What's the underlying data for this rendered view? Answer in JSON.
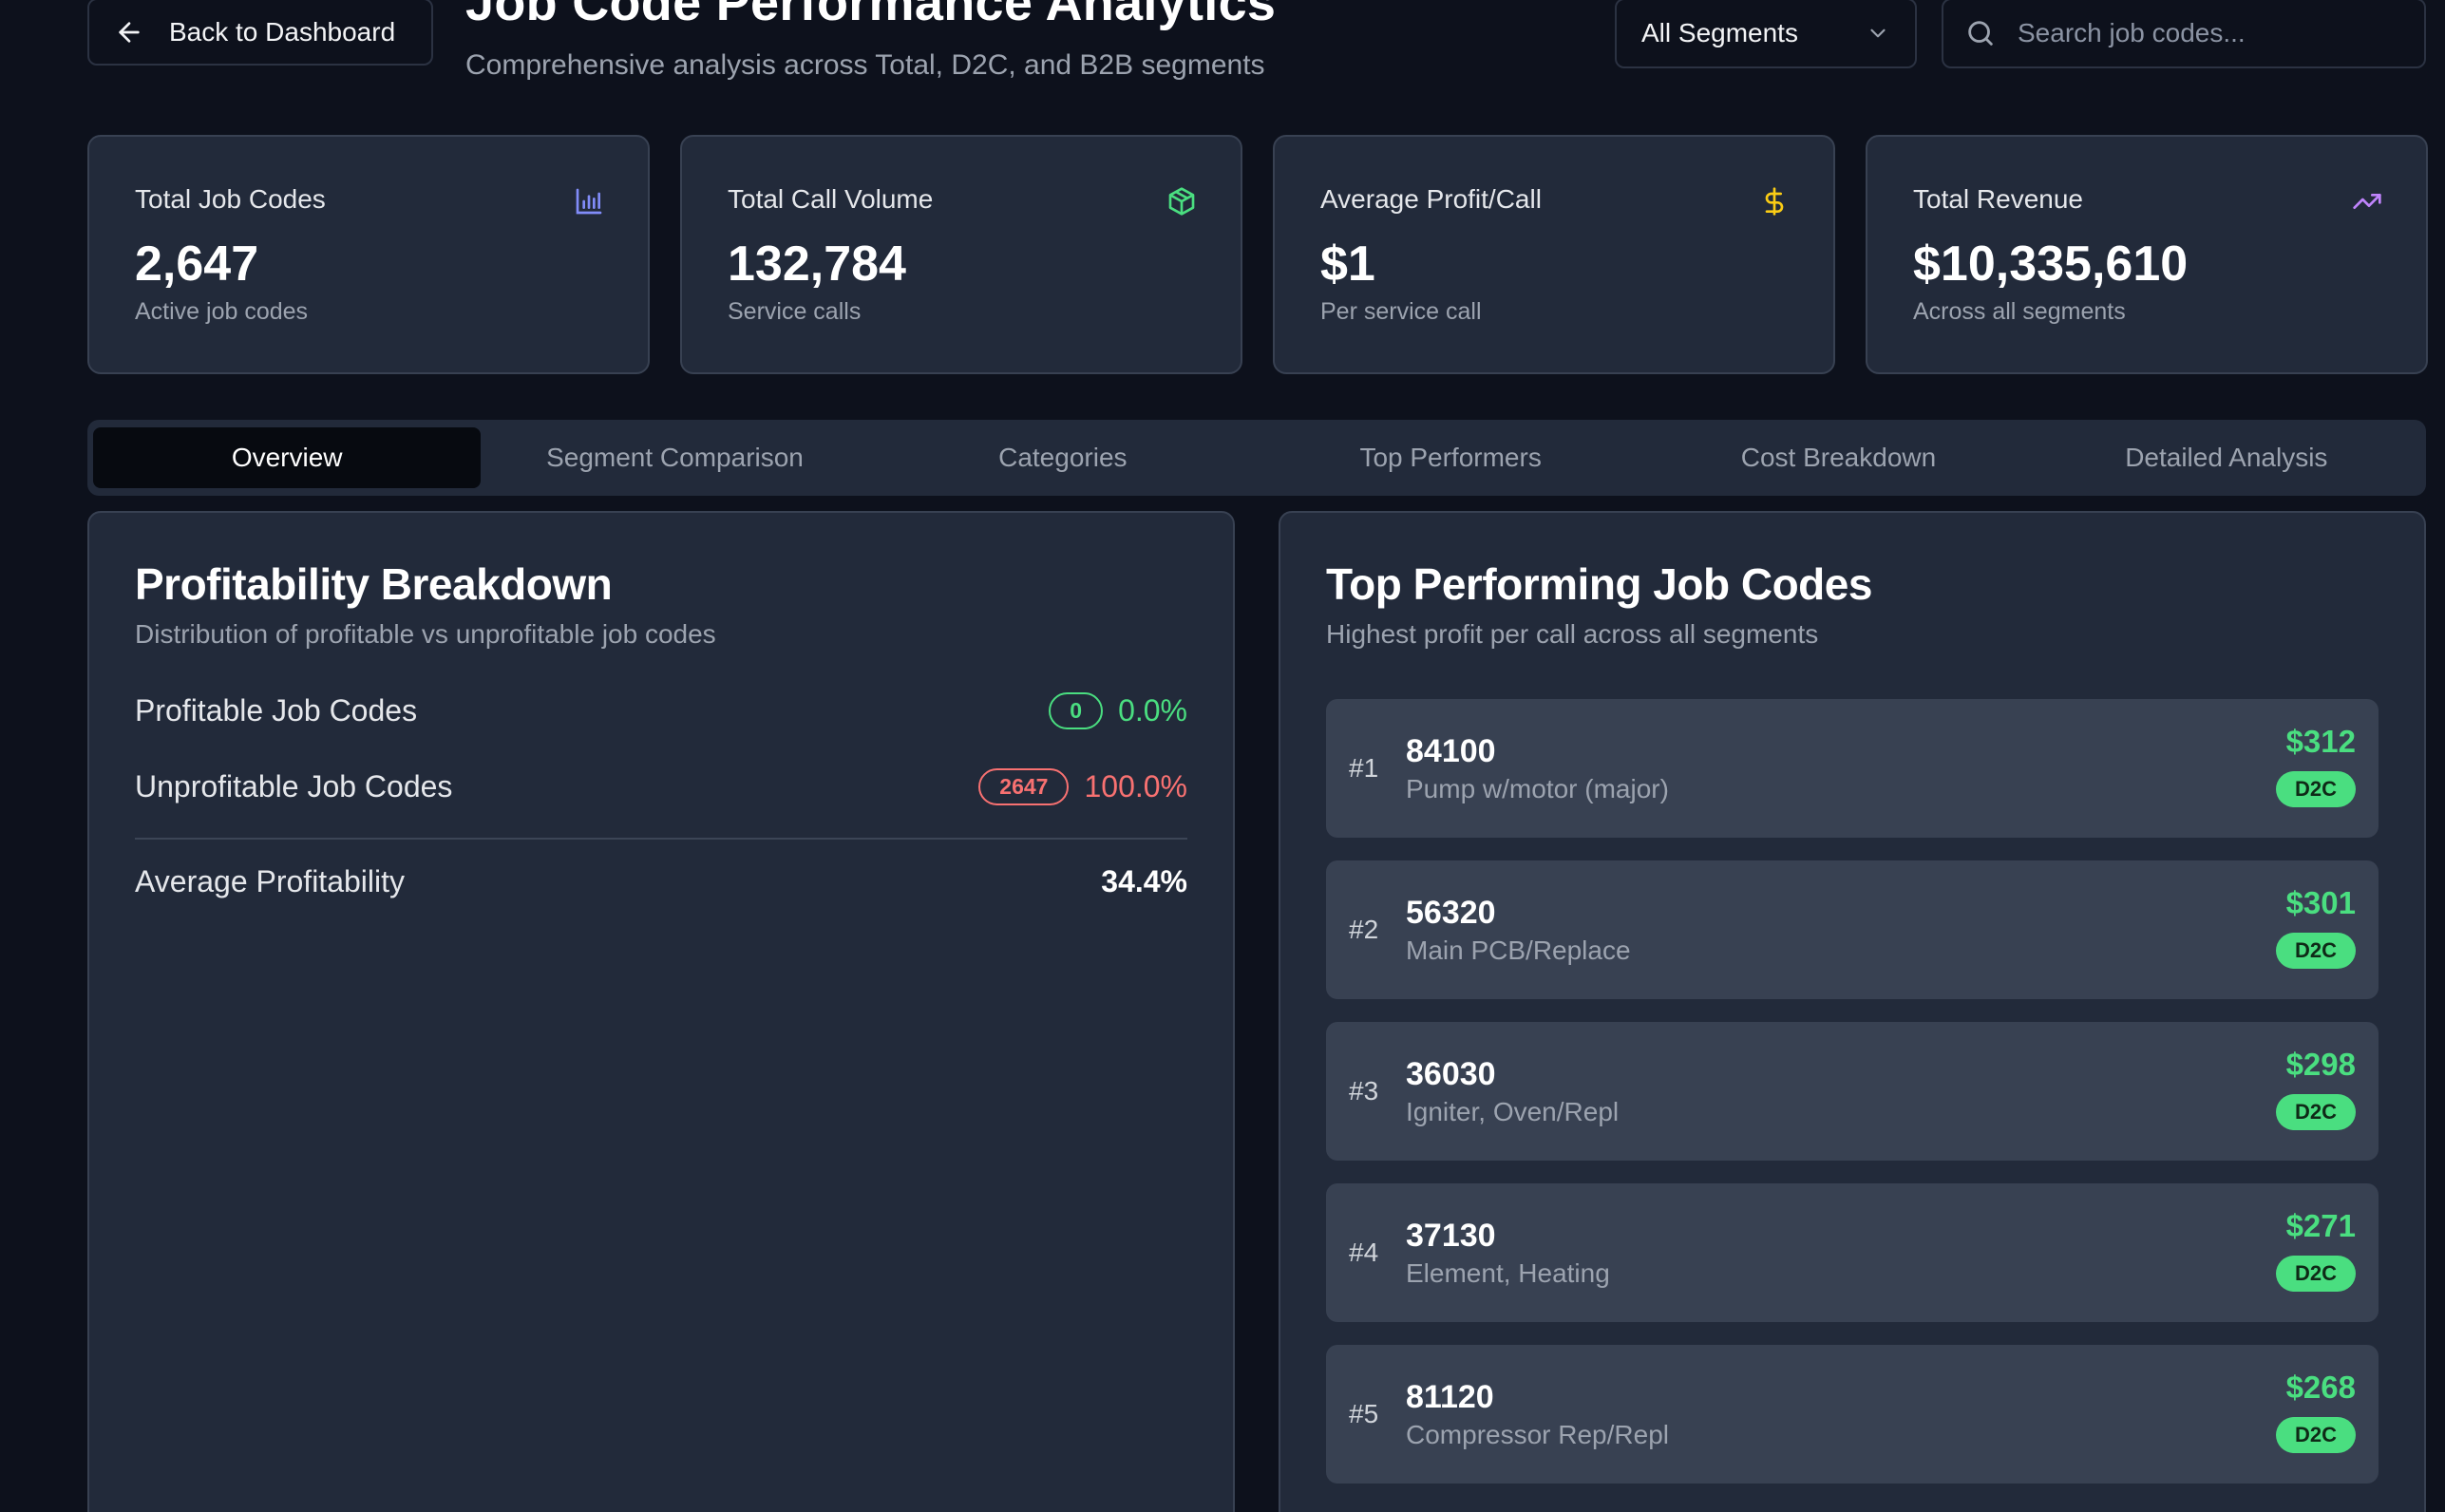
{
  "header": {
    "back_label": "Back to Dashboard",
    "title": "Job Code Performance Analytics",
    "subtitle": "Comprehensive analysis across Total, D2C, and B2B segments",
    "segment_selected": "All Segments",
    "search_placeholder": "Search job codes..."
  },
  "stats": [
    {
      "label": "Total Job Codes",
      "value": "2,647",
      "sub": "Active job codes",
      "icon": "bar-chart-icon",
      "icon_color": "#818cf8"
    },
    {
      "label": "Total Call Volume",
      "value": "132,784",
      "sub": "Service calls",
      "icon": "package-icon",
      "icon_color": "#4ade80"
    },
    {
      "label": "Average Profit/Call",
      "value": "$1",
      "sub": "Per service call",
      "icon": "dollar-icon",
      "icon_color": "#facc15"
    },
    {
      "label": "Total Revenue",
      "value": "$10,335,610",
      "sub": "Across all segments",
      "icon": "trending-up-icon",
      "icon_color": "#c084fc"
    }
  ],
  "tabs": [
    {
      "label": "Overview",
      "active": true
    },
    {
      "label": "Segment Comparison",
      "active": false
    },
    {
      "label": "Categories",
      "active": false
    },
    {
      "label": "Top Performers",
      "active": false
    },
    {
      "label": "Cost Breakdown",
      "active": false
    },
    {
      "label": "Detailed Analysis",
      "active": false
    }
  ],
  "profitability": {
    "title": "Profitability Breakdown",
    "subtitle": "Distribution of profitable vs unprofitable job codes",
    "profitable_label": "Profitable Job Codes",
    "profitable_count": "0",
    "profitable_pct": "0.0%",
    "unprofitable_label": "Unprofitable Job Codes",
    "unprofitable_count": "2647",
    "unprofitable_pct": "100.0%",
    "avg_label": "Average Profitability",
    "avg_value": "34.4%"
  },
  "top_performers": {
    "title": "Top Performing Job Codes",
    "subtitle": "Highest profit per call across all segments",
    "items": [
      {
        "rank": "#1",
        "code": "84100",
        "desc": "Pump w/motor (major)",
        "profit": "$312",
        "segment": "D2C"
      },
      {
        "rank": "#2",
        "code": "56320",
        "desc": "Main PCB/Replace",
        "profit": "$301",
        "segment": "D2C"
      },
      {
        "rank": "#3",
        "code": "36030",
        "desc": "Igniter, Oven/Repl",
        "profit": "$298",
        "segment": "D2C"
      },
      {
        "rank": "#4",
        "code": "37130",
        "desc": "Element, Heating",
        "profit": "$271",
        "segment": "D2C"
      },
      {
        "rank": "#5",
        "code": "81120",
        "desc": "Compressor Rep/Repl",
        "profit": "$268",
        "segment": "D2C"
      }
    ]
  },
  "colors": {
    "background": "#0d111c",
    "card": "#222a3a",
    "positive": "#4ade80",
    "negative": "#f87171"
  }
}
